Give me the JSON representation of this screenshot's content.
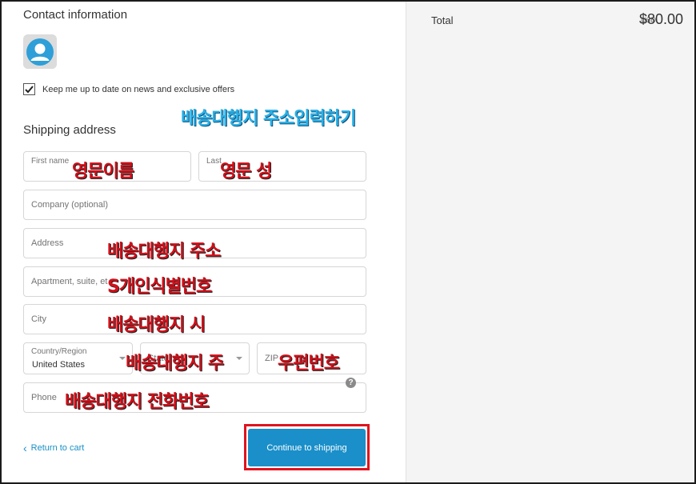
{
  "contact": {
    "heading": "Contact information"
  },
  "newsletter": {
    "label": "Keep me up to date on news and exclusive offers",
    "checked": true
  },
  "shipping": {
    "heading": "Shipping address"
  },
  "form": {
    "first_name": {
      "placeholder": "First name"
    },
    "last_name": {
      "placeholder": "Last"
    },
    "company": {
      "placeholder": "Company (optional)"
    },
    "address": {
      "placeholder": "Address"
    },
    "apartment": {
      "placeholder": "Apartment, suite, et"
    },
    "city": {
      "placeholder": "City"
    },
    "country": {
      "label": "Country/Region",
      "value": "United States"
    },
    "state": {
      "placeholder": "State"
    },
    "zip": {
      "placeholder": "ZIP"
    },
    "phone": {
      "placeholder": "Phone"
    }
  },
  "nav": {
    "return_label": "Return to cart",
    "continue_label": "Continue to shipping"
  },
  "summary": {
    "total_label": "Total",
    "currency": "USD",
    "total_amount": "$80.00"
  },
  "annotations": {
    "title": "배송대행지 주소입력하기",
    "first_name": "영문이름",
    "last_name": "영문 성",
    "address": "배송대행지 주소",
    "apartment": "S개인식별번호",
    "city": "배송대행지 시",
    "state": "배송대행지 주",
    "zip": "우편번호",
    "phone": "배송대행지 전화번호"
  },
  "colors": {
    "accent": "#1a8fc9",
    "highlight": "#e0141e",
    "annotation_red": "#d0101a",
    "annotation_blue": "#2ab0e6"
  }
}
